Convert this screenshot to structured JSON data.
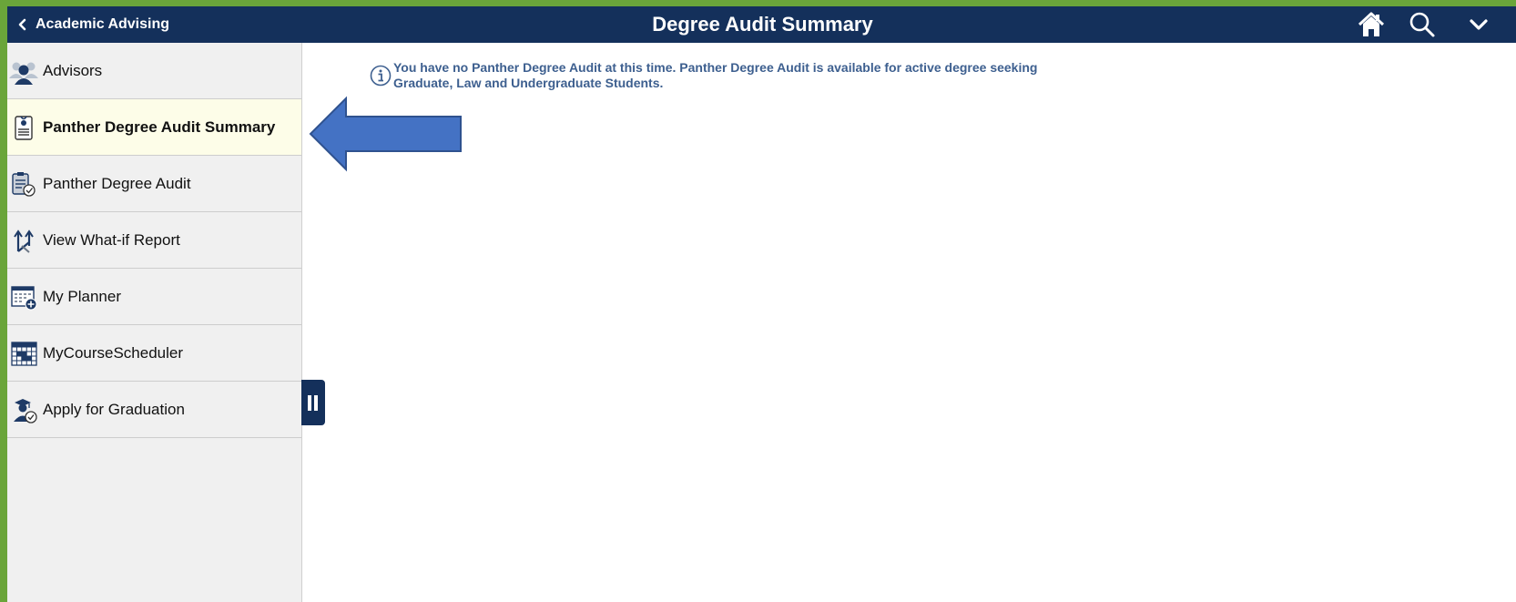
{
  "header": {
    "back_label": "Academic Advising",
    "title": "Degree Audit Summary",
    "icons": [
      "home-icon",
      "search-icon",
      "chevron-down-icon"
    ]
  },
  "sidebar": {
    "items": [
      {
        "label": "Advisors",
        "icon": "advisors-icon",
        "active": false
      },
      {
        "label": "Panther Degree Audit Summary",
        "icon": "document-icon",
        "active": true
      },
      {
        "label": "Panther Degree Audit",
        "icon": "audit-clipboard-icon",
        "active": false
      },
      {
        "label": "View What-if Report",
        "icon": "what-if-arrows-icon",
        "active": false
      },
      {
        "label": "My Planner",
        "icon": "planner-calendar-icon",
        "active": false
      },
      {
        "label": "MyCourseScheduler",
        "icon": "scheduler-grid-icon",
        "active": false
      },
      {
        "label": "Apply for Graduation",
        "icon": "graduation-icon",
        "active": false
      }
    ]
  },
  "main": {
    "info_line1": "You have no Panther Degree Audit at this time. Panther Degree Audit is available for active degree seeking",
    "info_line2": "Graduate, Law and Undergraduate Students."
  },
  "colors": {
    "header_bg": "#14305b",
    "frame_border": "#6aa53a",
    "active_item_bg": "#fdfde8",
    "info_text": "#3d5f8f",
    "arrow_fill": "#4472c4"
  }
}
